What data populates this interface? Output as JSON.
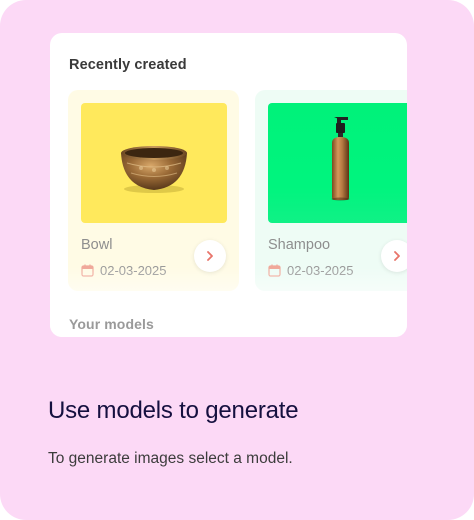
{
  "preview": {
    "section_title": "Recently created",
    "second_section_title": "Your models",
    "models": [
      {
        "name": "Bowl",
        "date": "02-03-2025",
        "image_icon": "singing-bowl-image",
        "thumb_color": "#ffe95c"
      },
      {
        "name": "Shampoo",
        "date": "02-03-2025",
        "image_icon": "shampoo-bottle-image",
        "thumb_color": "#00f27a"
      }
    ]
  },
  "onboarding": {
    "title": "Use models to generate",
    "description": "To generate images select a model."
  },
  "colors": {
    "background": "#fcd9f6",
    "title": "#15103f",
    "accent": "#e8746a"
  }
}
